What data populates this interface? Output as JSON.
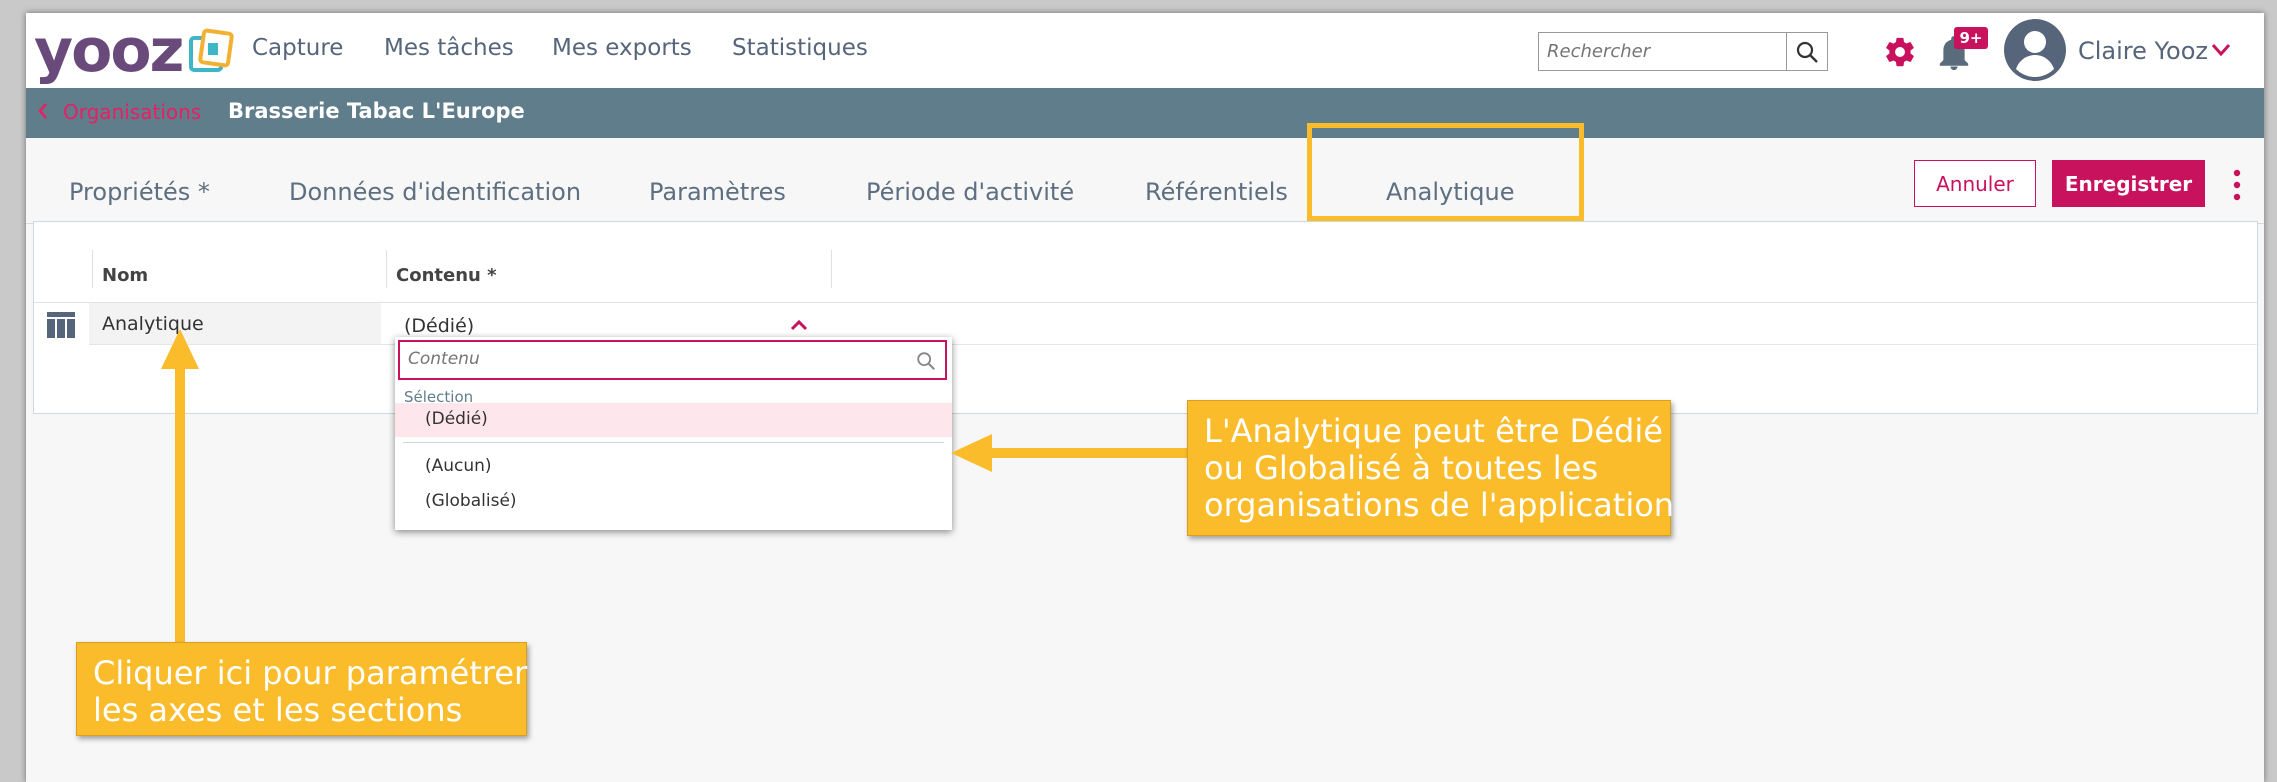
{
  "brand": {
    "logo_text": "yooz",
    "accent_color": "#c8125e",
    "highlight_color": "#fbbc2c"
  },
  "topnav": {
    "items": [
      {
        "label": "Capture"
      },
      {
        "label": "Mes tâches"
      },
      {
        "label": "Mes exports"
      },
      {
        "label": "Statistiques"
      }
    ],
    "search": {
      "placeholder": "Rechercher",
      "icon": "search-icon"
    },
    "settings_icon": "gear-icon",
    "notifications": {
      "icon": "bell-icon",
      "badge": "9+"
    },
    "user": {
      "name": "Claire Yooz",
      "avatar_icon": "user-avatar-icon",
      "menu_icon": "chevron-down-icon"
    }
  },
  "breadcrumb": {
    "back_icon": "chevron-left-icon",
    "parent": "Organisations",
    "current": "Brasserie Tabac L'Europe"
  },
  "tabs": [
    {
      "label": "Propriétés *"
    },
    {
      "label": "Données d'identification"
    },
    {
      "label": "Paramètres"
    },
    {
      "label": "Période d'activité"
    },
    {
      "label": "Référentiels"
    },
    {
      "label": "Analytique",
      "active": true
    }
  ],
  "actions": {
    "cancel": "Annuler",
    "save": "Enregistrer",
    "more_icon": "kebab-menu-icon"
  },
  "grid": {
    "columns": [
      "Nom",
      "Contenu *"
    ],
    "rows": [
      {
        "icon": "table-columns-icon",
        "name": "Analytique",
        "value": "(Dédié)"
      }
    ]
  },
  "dropdown": {
    "placeholder": "Contenu",
    "group_label": "Sélection",
    "options": [
      {
        "label": "(Dédié)",
        "selected": true
      },
      {
        "label": "(Aucun)"
      },
      {
        "label": "(Globalisé)"
      }
    ]
  },
  "annotations": {
    "right": [
      "L'Analytique peut être Dédié",
      "ou Globalisé à toutes les",
      "organisations de l'application"
    ],
    "left": [
      "Cliquer ici pour paramétrer",
      "les axes et les sections"
    ]
  }
}
